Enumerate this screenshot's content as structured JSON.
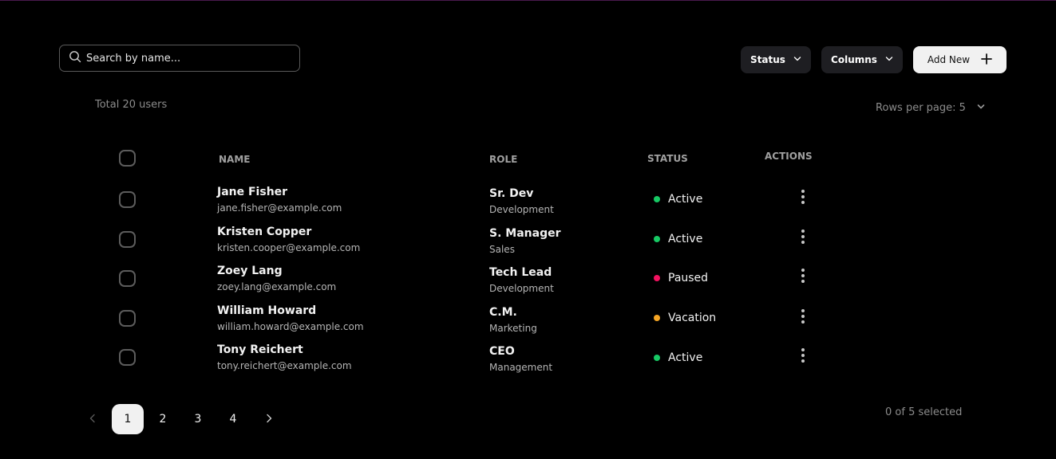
{
  "search": {
    "placeholder": "Search by name..."
  },
  "toolbar": {
    "status_label": "Status",
    "columns_label": "Columns",
    "add_label": "Add New"
  },
  "summary": {
    "total": "Total 20 users",
    "rows_per_page": "Rows per page: 5"
  },
  "table": {
    "headers": {
      "name": "NAME",
      "role": "ROLE",
      "status": "STATUS",
      "actions": "ACTIONS"
    },
    "rows": [
      {
        "name": "Jane Fisher",
        "email": "jane.fisher@example.com",
        "role": "Sr. Dev",
        "dept": "Development",
        "status": "Active",
        "status_color": "#17c964"
      },
      {
        "name": "Kristen Copper",
        "email": "kristen.cooper@example.com",
        "role": "S. Manager",
        "dept": "Sales",
        "status": "Active",
        "status_color": "#17c964"
      },
      {
        "name": "Zoey Lang",
        "email": "zoey.lang@example.com",
        "role": "Tech Lead",
        "dept": "Development",
        "status": "Paused",
        "status_color": "#f31260"
      },
      {
        "name": "William Howard",
        "email": "william.howard@example.com",
        "role": "C.M.",
        "dept": "Marketing",
        "status": "Vacation",
        "status_color": "#f5a524"
      },
      {
        "name": "Tony Reichert",
        "email": "tony.reichert@example.com",
        "role": "CEO",
        "dept": "Management",
        "status": "Active",
        "status_color": "#17c964"
      }
    ]
  },
  "pagination": {
    "pages": [
      "1",
      "2",
      "3",
      "4"
    ],
    "current": "1",
    "selected": "0 of 5 selected"
  },
  "icons": {
    "search": "search-icon",
    "chevron": "chevron-down-icon",
    "plus": "plus-icon",
    "kebab": "more-vertical-icon",
    "prev": "chevron-left-icon",
    "next": "chevron-right-icon"
  }
}
